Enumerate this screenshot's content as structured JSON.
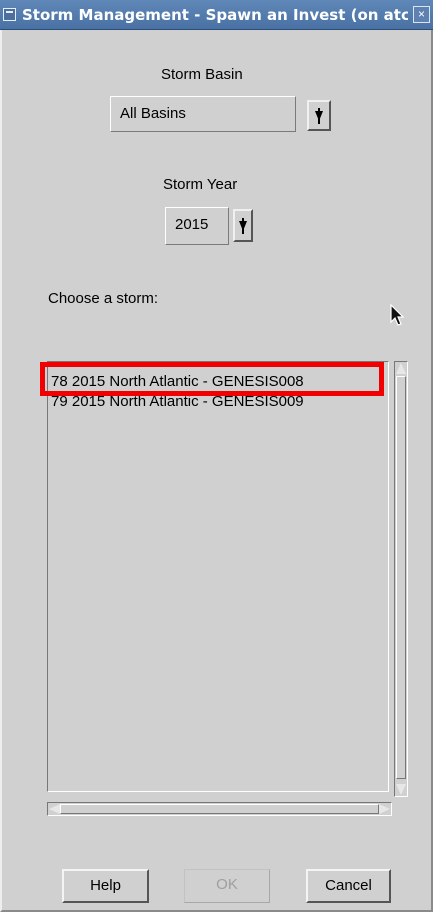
{
  "window": {
    "title": "Storm Management - Spawn an Invest (on atc",
    "close_icon": "×"
  },
  "storm_basin": {
    "label": "Storm Basin",
    "selected": "All Basins"
  },
  "storm_year": {
    "label": "Storm Year",
    "selected": "2015"
  },
  "storm_list": {
    "label": "Choose a storm:",
    "items": [
      "78 2015 North Atlantic - GENESIS008",
      "79 2015 North Atlantic - GENESIS009"
    ]
  },
  "buttons": {
    "help": "Help",
    "ok": "OK",
    "cancel": "Cancel"
  },
  "colors": {
    "title_bar": "#4a71a3",
    "highlight": "#f00000",
    "window_background": "#d0d0d0"
  },
  "icons": {
    "window_menu": "window-menu-icon",
    "close": "close-icon",
    "dropdown": "dropdown-icon",
    "scroll": "scroll-arrow-icon",
    "cursor": "mouse-pointer-icon"
  }
}
